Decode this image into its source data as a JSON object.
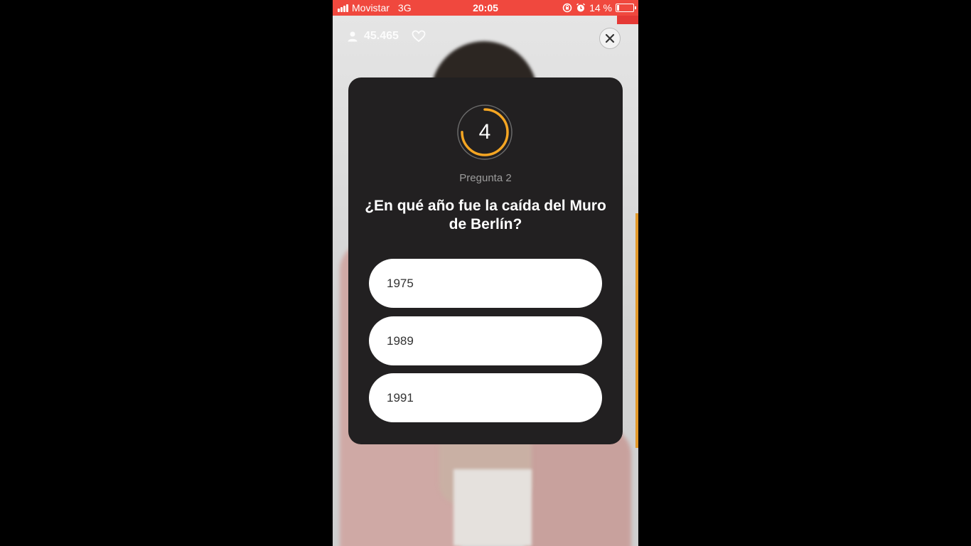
{
  "status_bar": {
    "carrier": "Movistar",
    "network": "3G",
    "time": "20:05",
    "battery_text": "14 %",
    "battery_level": 0.14,
    "icons": [
      "signal-icon",
      "rotation-lock-icon",
      "alarm-icon",
      "battery-icon"
    ]
  },
  "overlay": {
    "viewers": "45.465",
    "icons": [
      "user-icon",
      "heart-icon",
      "close-icon"
    ]
  },
  "quiz": {
    "timer_value": "4",
    "timer_progress": 0.75,
    "question_number": "Pregunta 2",
    "question": "¿En qué año fue la caída del Muro de Berlín?",
    "answers": [
      "1975",
      "1989",
      "1991"
    ]
  },
  "colors": {
    "status_bar": "#f0483e",
    "card": "#222021",
    "timer_ring": "#f5a623",
    "answer_bg": "#ffffff"
  }
}
